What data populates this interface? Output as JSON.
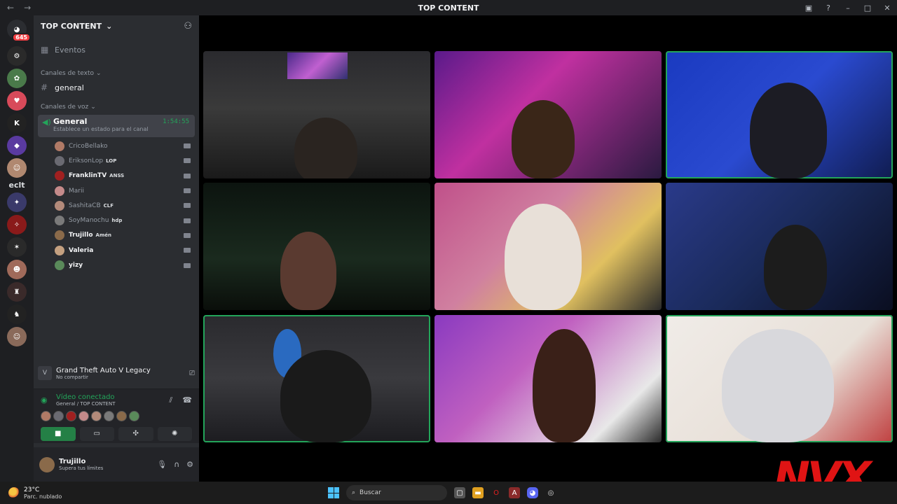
{
  "window": {
    "title": "TOP CONTENT"
  },
  "rail": {
    "home_badge": "645",
    "text_server": "eclt"
  },
  "guild": {
    "name": "TOP CONTENT",
    "events_label": "Eventos",
    "text_category": "Canales de texto",
    "text_channel": "general",
    "voice_category": "Canales de voz",
    "voice_channel": {
      "name": "General",
      "timer": "1:54:55",
      "status": "Establece un estado para el canal"
    },
    "members": [
      {
        "name": "CricoBellako",
        "tag": "",
        "bold": false,
        "color": "#b07a66"
      },
      {
        "name": "EriksonLop",
        "tag": "LOP",
        "bold": false,
        "color": "#6a6a72"
      },
      {
        "name": "FranklinTV",
        "tag": "ANSS",
        "bold": true,
        "color": "#a02020"
      },
      {
        "name": "Marii",
        "tag": "",
        "bold": false,
        "color": "#c48a8a"
      },
      {
        "name": "SashitaCB",
        "tag": "CLF",
        "bold": false,
        "color": "#b38a7a"
      },
      {
        "name": "SoyManochu",
        "tag": "hdp",
        "bold": false,
        "color": "#7a7a7a"
      },
      {
        "name": "Trujillo",
        "tag": "Amén",
        "bold": true,
        "color": "#8a6a4a"
      },
      {
        "name": "Valeria",
        "tag": "",
        "bold": true,
        "color": "#c4a080"
      },
      {
        "name": "yizy",
        "tag": "",
        "bold": true,
        "color": "#5a8a5a"
      }
    ]
  },
  "activity": {
    "game": "Grand Theft Auto V Legacy",
    "status": "No compartir"
  },
  "voice_panel": {
    "connected_label": "Vídeo conectado",
    "location": "General / TOP CONTENT"
  },
  "user": {
    "name": "Trujillo",
    "status": "Supera tus límites"
  },
  "taskbar": {
    "temperature": "23°C",
    "condition": "Parc. nublado",
    "search_placeholder": "Buscar"
  },
  "watermark": "NVX",
  "colors": {
    "speaking_outline": "#23a55a",
    "accent_green": "#23a55a",
    "bg_sidebar": "#2b2d31",
    "bg_rail": "#1e1f22"
  }
}
